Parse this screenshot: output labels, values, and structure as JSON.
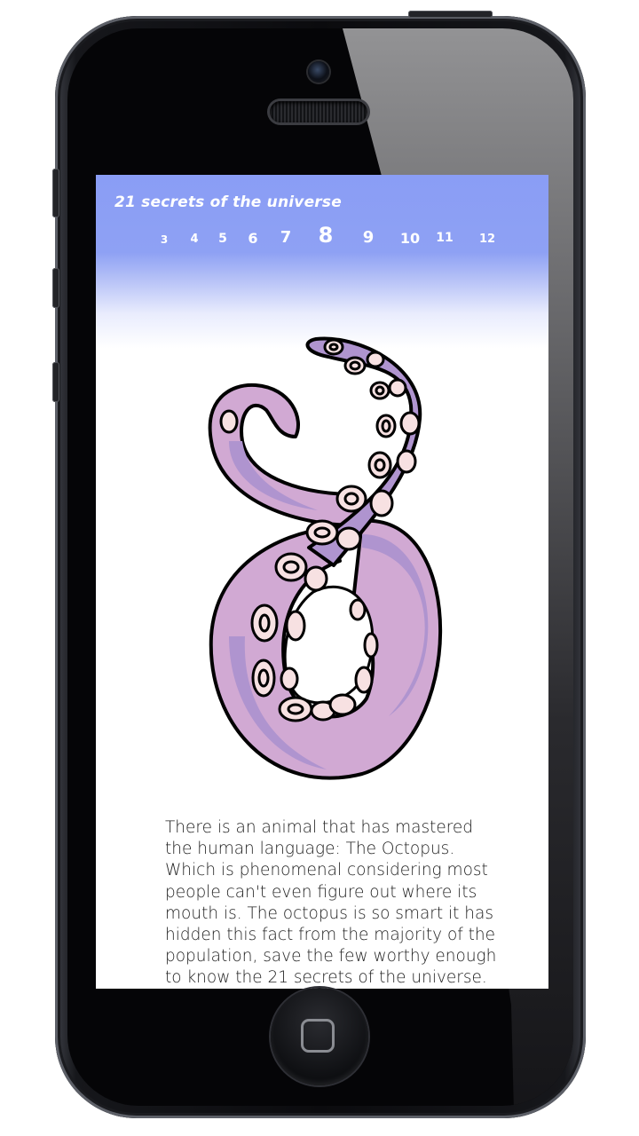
{
  "app": {
    "title": "21 secrets of the universe"
  },
  "pager": {
    "pages": [
      {
        "label": "3"
      },
      {
        "label": "4"
      },
      {
        "label": "5"
      },
      {
        "label": "6"
      },
      {
        "label": "7"
      },
      {
        "label": "8",
        "current": true
      },
      {
        "label": "9"
      },
      {
        "label": "10"
      },
      {
        "label": "11"
      },
      {
        "label": "12"
      }
    ]
  },
  "content": {
    "illustration": "octopus-tentacle-number-eight",
    "text": "There is an animal that has mastered the human language: The Octopus. Which is phenomenal considering most people can't even figure out where its mouth is. The octopus is so smart it has hidden this fact from the majority of the population, save the few worthy enough to know the 21 secrets of the universe."
  },
  "colors": {
    "header": "#8a9df5",
    "tentacle_light": "#d1a9d3",
    "tentacle_dark": "#af94cf",
    "sucker": "#f7e1e2",
    "outline": "#000000"
  },
  "device": {
    "icons": [
      "front-camera-icon",
      "speaker-grille-icon",
      "home-button-icon"
    ]
  }
}
